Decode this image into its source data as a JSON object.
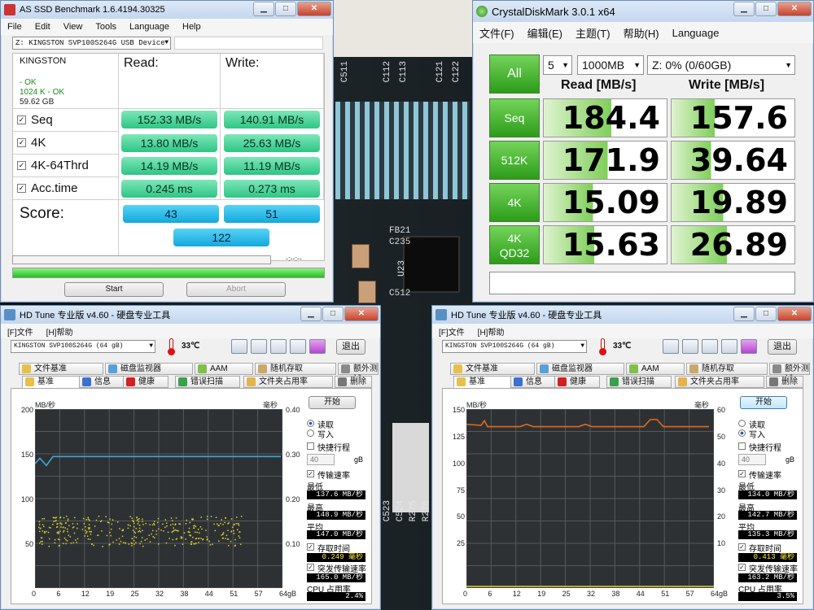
{
  "asssd": {
    "title": "AS SSD Benchmark 1.6.4194.30325",
    "menu": [
      "File",
      "Edit",
      "View",
      "Tools",
      "Language",
      "Help"
    ],
    "drive_select": "Z: KINGSTON  SVP100S264G USB Device",
    "drive_info": {
      "name": "KINGSTON",
      "line1": "- OK",
      "line2": "1024 K - OK",
      "size": "59.62 GB"
    },
    "read_header": "Read:",
    "write_header": "Write:",
    "rows": [
      {
        "label": "Seq",
        "read": "152.33 MB/s",
        "write": "140.91 MB/s"
      },
      {
        "label": "4K",
        "read": "13.80 MB/s",
        "write": "25.63 MB/s"
      },
      {
        "label": "4K-64Thrd",
        "read": "14.19 MB/s",
        "write": "11.19 MB/s"
      },
      {
        "label": "Acc.time",
        "read": "0.245 ms",
        "write": "0.273 ms"
      }
    ],
    "score_label": "Score:",
    "score_read": "43",
    "score_write": "51",
    "score_total": "122",
    "progress_text": "-:--:--",
    "progress": 1.0,
    "start": "Start",
    "abort": "Abort"
  },
  "cdm": {
    "title": "CrystalDiskMark 3.0.1 x64",
    "menu": [
      "文件(F)",
      "编辑(E)",
      "主题(T)",
      "帮助(H)",
      "Language"
    ],
    "all": "All",
    "count": "5",
    "size": "1000MB",
    "drive": "Z: 0% (0/60GB)",
    "read_header": "Read [MB/s]",
    "write_header": "Write [MB/s]",
    "rows": [
      {
        "label": "Seq",
        "label2": "",
        "read": "184.4",
        "write": "157.6",
        "read_frac": 0.55,
        "write_frac": 0.35
      },
      {
        "label": "512K",
        "label2": "",
        "read": "171.9",
        "write": "39.64",
        "read_frac": 0.52,
        "write_frac": 0.32
      },
      {
        "label": "4K",
        "label2": "",
        "read": "15.09",
        "write": "19.89",
        "read_frac": 0.4,
        "write_frac": 0.42
      },
      {
        "label": "4K",
        "label2": "QD32",
        "read": "15.63",
        "write": "26.89",
        "read_frac": 0.41,
        "write_frac": 0.45
      }
    ],
    "comment": ""
  },
  "hdtune_left": {
    "title": "HD Tune 专业版 v4.60 - 硬盘专业工具",
    "menu": [
      "[F]文件",
      "[H]帮助"
    ],
    "drive": "KINGSTON  SVP100S264G    (64 gB)",
    "temp": "33℃",
    "exit": "退出",
    "tabs_row1": [
      "文件基准",
      "磁盘监视器",
      "AAM",
      "随机存取",
      "额外测试"
    ],
    "tabs_row2": [
      "基准",
      "信息",
      "健康",
      "错误扫描",
      "文件夹占用率",
      "删除"
    ],
    "start": "开始",
    "unit_left": "MB/秒",
    "unit_right": "毫秒",
    "y_left": [
      "200",
      "150",
      "100",
      "50"
    ],
    "y_right": [
      "0.40",
      "0.30",
      "0.20",
      "0.10"
    ],
    "x_ticks": [
      "0",
      "6",
      "12",
      "19",
      "25",
      "32",
      "38",
      "44",
      "51",
      "57",
      "64gB"
    ],
    "read_label": "读取",
    "write_label": "写入",
    "mode": "read",
    "short_stroke": "快捷行程",
    "short_val": "40",
    "short_unit": "gB",
    "transfer_rate": "传输速率",
    "min_label": "最低",
    "min_val": "137.6 MB/秒",
    "max_label": "最高",
    "max_val": "148.9 MB/秒",
    "avg_label": "平均",
    "avg_val": "147.0 MB/秒",
    "access_label": "存取时间",
    "access_val": "0.249 毫秒",
    "burst_label": "突发传输速率",
    "burst_val": "165.0 MB/秒",
    "cpu_label": "CPU 占用率",
    "cpu_val": "2.4%",
    "avg_rate": 147,
    "y_max": 200
  },
  "hdtune_right": {
    "title": "HD Tune 专业版 v4.60 - 硬盘专业工具",
    "menu": [
      "[F]文件",
      "[H]帮助"
    ],
    "drive": "KINGSTON  SVP100S264G    (64 gB)",
    "temp": "33℃",
    "exit": "退出",
    "tabs_row1": [
      "文件基准",
      "磁盘监视器",
      "AAM",
      "随机存取",
      "额外测试"
    ],
    "tabs_row2": [
      "基准",
      "信息",
      "健康",
      "错误扫描",
      "文件夹占用率",
      "删除"
    ],
    "start": "开始",
    "unit_left": "MB/秒",
    "unit_right": "毫秒",
    "y_left": [
      "150",
      "125",
      "100",
      "75",
      "50",
      "25"
    ],
    "y_right": [
      "60",
      "50",
      "40",
      "30",
      "20",
      "10"
    ],
    "x_ticks": [
      "0",
      "6",
      "12",
      "19",
      "25",
      "32",
      "38",
      "44",
      "51",
      "57",
      "64gB"
    ],
    "read_label": "读取",
    "write_label": "写入",
    "mode": "write",
    "short_stroke": "快捷行程",
    "short_val": "40",
    "short_unit": "gB",
    "transfer_rate": "传输速率",
    "min_label": "最低",
    "min_val": "134.0 MB/秒",
    "max_label": "最高",
    "max_val": "142.7 MB/秒",
    "avg_label": "平均",
    "avg_val": "135.3 MB/秒",
    "access_label": "存取时间",
    "access_val": "0.413 毫秒",
    "burst_label": "突发传输速率",
    "burst_val": "163.2 MB/秒",
    "cpu_label": "CPU 占用率",
    "cpu_val": "3.5%",
    "avg_rate": 135.3,
    "y_max": 150
  },
  "photo_labels": [
    "C511",
    "C112",
    "C113",
    "C121",
    "C122",
    "FB21",
    "C235",
    "U23",
    "C512",
    "C523",
    "C524",
    "R275",
    "R276"
  ],
  "colors": {
    "green_btn": "#2fc585",
    "blue_btn": "#13a8dc",
    "cdm_green": "#2c9c19",
    "hd_read_line": "#3aa6dc",
    "hd_write_line": "#e06a1c",
    "hd_scatter": "#d8d22a"
  }
}
